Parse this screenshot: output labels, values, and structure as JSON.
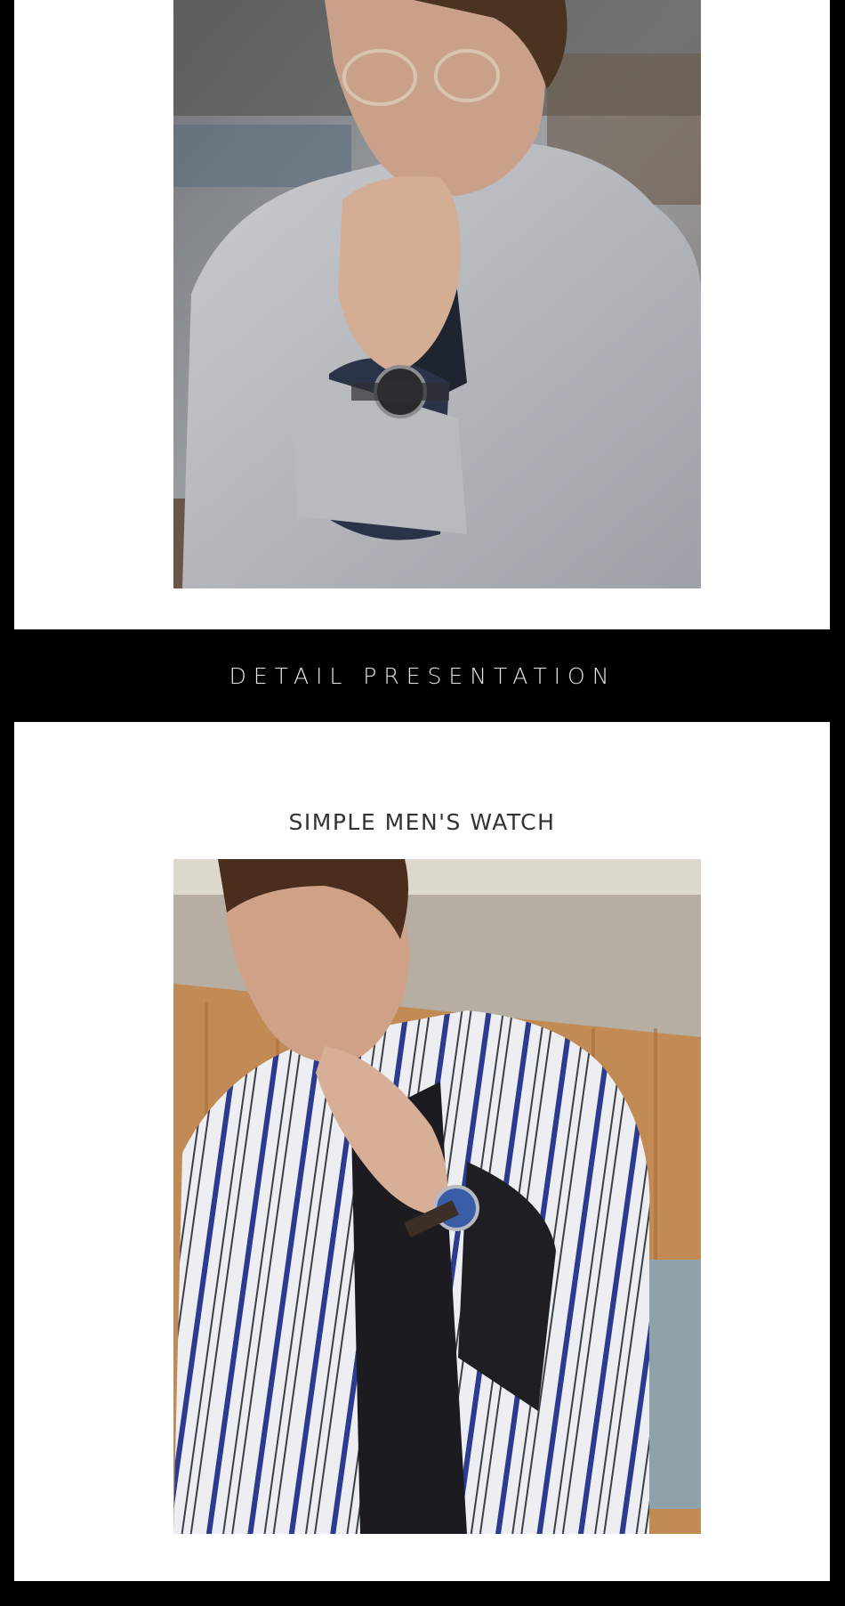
{
  "banner": {
    "title": "DETAIL PRESENTATION"
  },
  "section": {
    "subtitle": "SIMPLE MEN'S WATCH"
  },
  "colors": {
    "background": "#000000",
    "panel": "#ffffff",
    "banner_text": "#e6e6e6",
    "subtitle_text": "#333333"
  }
}
